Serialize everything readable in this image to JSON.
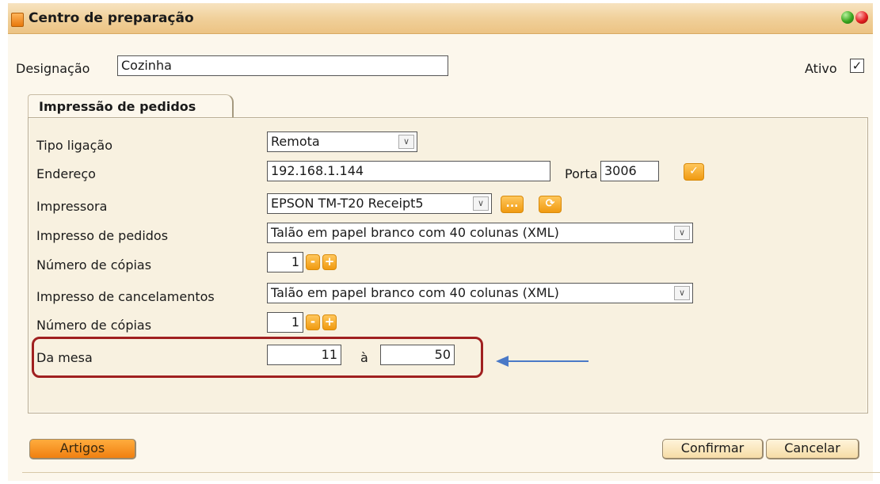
{
  "window": {
    "title": "Centro de preparação"
  },
  "header": {
    "designacao_label": "Designação",
    "designacao_value": "Cozinha",
    "ativo_label": "Ativo",
    "ativo_checked": true,
    "check_glyph": "✓"
  },
  "tabs": [
    {
      "label": "Impressão de pedidos"
    }
  ],
  "form": {
    "tipo_ligacao": {
      "label": "Tipo ligação",
      "value": "Remota"
    },
    "endereco": {
      "label": "Endereço",
      "value": "192.168.1.144"
    },
    "porta": {
      "label": "Porta",
      "value": "3006"
    },
    "impressora": {
      "label": "Impressora",
      "value": "EPSON TM-T20 Receipt5"
    },
    "impresso_pedidos": {
      "label": "Impresso de pedidos",
      "value": "Talão em papel branco com 40 colunas (XML)"
    },
    "copias_pedidos": {
      "label": "Número de cópias",
      "value": "1"
    },
    "impresso_cancelamentos": {
      "label": "Impresso de cancelamentos",
      "value": "Talão em papel branco com 40 colunas (XML)"
    },
    "copias_cancelamentos": {
      "label": "Número de cópias",
      "value": "1"
    },
    "da_mesa": {
      "label": "Da mesa",
      "from": "11",
      "separator": "à",
      "to": "50"
    }
  },
  "glyphs": {
    "minus": "-",
    "plus": "+",
    "check": "✓",
    "dots": "...",
    "refresh": "⟳",
    "dropdown": "∨"
  },
  "footer": {
    "artigos": "Artigos",
    "confirmar": "Confirmar",
    "cancelar": "Cancelar"
  },
  "colors": {
    "accent_orange": "#f09a11",
    "highlight_red": "#a02020",
    "arrow_blue": "#4a79c7"
  }
}
